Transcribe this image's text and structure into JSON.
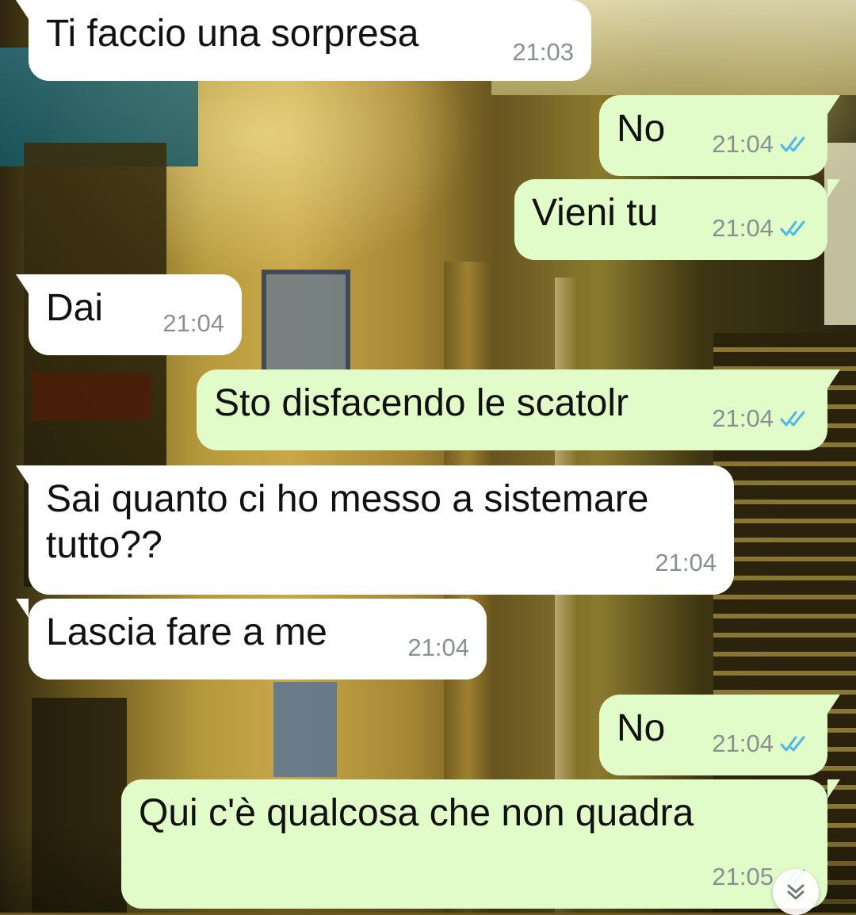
{
  "chat": {
    "messages": [
      {
        "direction": "incoming",
        "text": "Ti faccio una sorpresa",
        "time": "21:03"
      },
      {
        "direction": "outgoing",
        "text": "No",
        "time": "21:04",
        "status": "read"
      },
      {
        "direction": "outgoing",
        "text": "Vieni tu",
        "time": "21:04",
        "status": "read"
      },
      {
        "direction": "incoming",
        "text": "Dai",
        "time": "21:04"
      },
      {
        "direction": "outgoing",
        "text": "Sto disfacendo le scatolr",
        "time": "21:04",
        "status": "read"
      },
      {
        "direction": "incoming",
        "text": "Sai quanto ci ho messo a sistemare\ntutto??",
        "time": "21:04"
      },
      {
        "direction": "incoming",
        "text": "Lascia fare a me",
        "time": "21:04"
      },
      {
        "direction": "outgoing",
        "text": "No",
        "time": "21:04",
        "status": "read"
      },
      {
        "direction": "outgoing",
        "text": "Qui c'è qualcosa che non quadra",
        "time": "21:05",
        "status": "read"
      }
    ],
    "read_tick_color": "#4fb6ec",
    "incoming_bubble_color": "#ffffff",
    "outgoing_bubble_color": "#e2fcc9"
  },
  "controls": {
    "scroll_down_icon": "double-chevron-down-icon"
  }
}
